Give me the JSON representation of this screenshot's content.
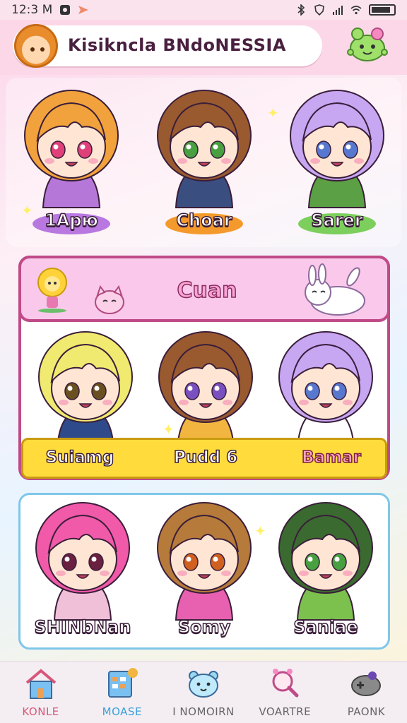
{
  "status_bar": {
    "time": "12:3 M",
    "icons": [
      "notification-icon",
      "send-icon",
      "bluetooth-icon",
      "shield-icon",
      "signal-icon",
      "wifi-icon",
      "battery-icon"
    ]
  },
  "header": {
    "title": "Kisikncla BNdoNESSIA",
    "avatar": "fox-avatar-icon",
    "mascot": "frog-mascot-icon"
  },
  "top_row": {
    "characters": [
      {
        "name": "1Apю",
        "hair": "#f2a23c",
        "eyes": "#e0407a",
        "outfit": "#b678d8",
        "base": "#b878e0"
      },
      {
        "name": "Choar",
        "hair": "#9a5a30",
        "eyes": "#48a040",
        "outfit": "#3b4e80",
        "base": "#f49a2c"
      },
      {
        "name": "Sarer",
        "hair": "#c7a6f2",
        "eyes": "#5878d0",
        "outfit": "#5ba045",
        "base": "#7ccf5c"
      }
    ]
  },
  "section": {
    "title": "Cuan",
    "characters": [
      {
        "name": "Suiamg",
        "hair": "#f0ea70",
        "eyes": "#6a5020",
        "outfit": "#2e4a8a"
      },
      {
        "name": "Pudd 6",
        "hair": "#9a5a30",
        "eyes": "#7a50c0",
        "outfit": "#f2b640"
      },
      {
        "name": "Bamar",
        "hair": "#c7a6f2",
        "eyes": "#5878d0",
        "outfit": "#ffffff"
      }
    ]
  },
  "bottom_row": {
    "characters": [
      {
        "name": "SHINbNan",
        "hair": "#f05aa8",
        "eyes": "#6a2040",
        "outfit": "#f0c0d8"
      },
      {
        "name": "Somy",
        "hair": "#b67a3a",
        "eyes": "#d06020",
        "outfit": "#e860b0"
      },
      {
        "name": "Saniae",
        "hair": "#3a6a30",
        "eyes": "#48a040",
        "outfit": "#7cc04e"
      }
    ]
  },
  "bottom_nav": {
    "items": [
      {
        "label": "KONLE",
        "icon": "home-icon"
      },
      {
        "label": "MOASE",
        "icon": "calendar-icon"
      },
      {
        "label": "I NOMOIRN",
        "icon": "bear-face-icon"
      },
      {
        "label": "VOARTRE",
        "icon": "search-icon"
      },
      {
        "label": "PAONK",
        "icon": "gamepad-icon"
      }
    ]
  }
}
